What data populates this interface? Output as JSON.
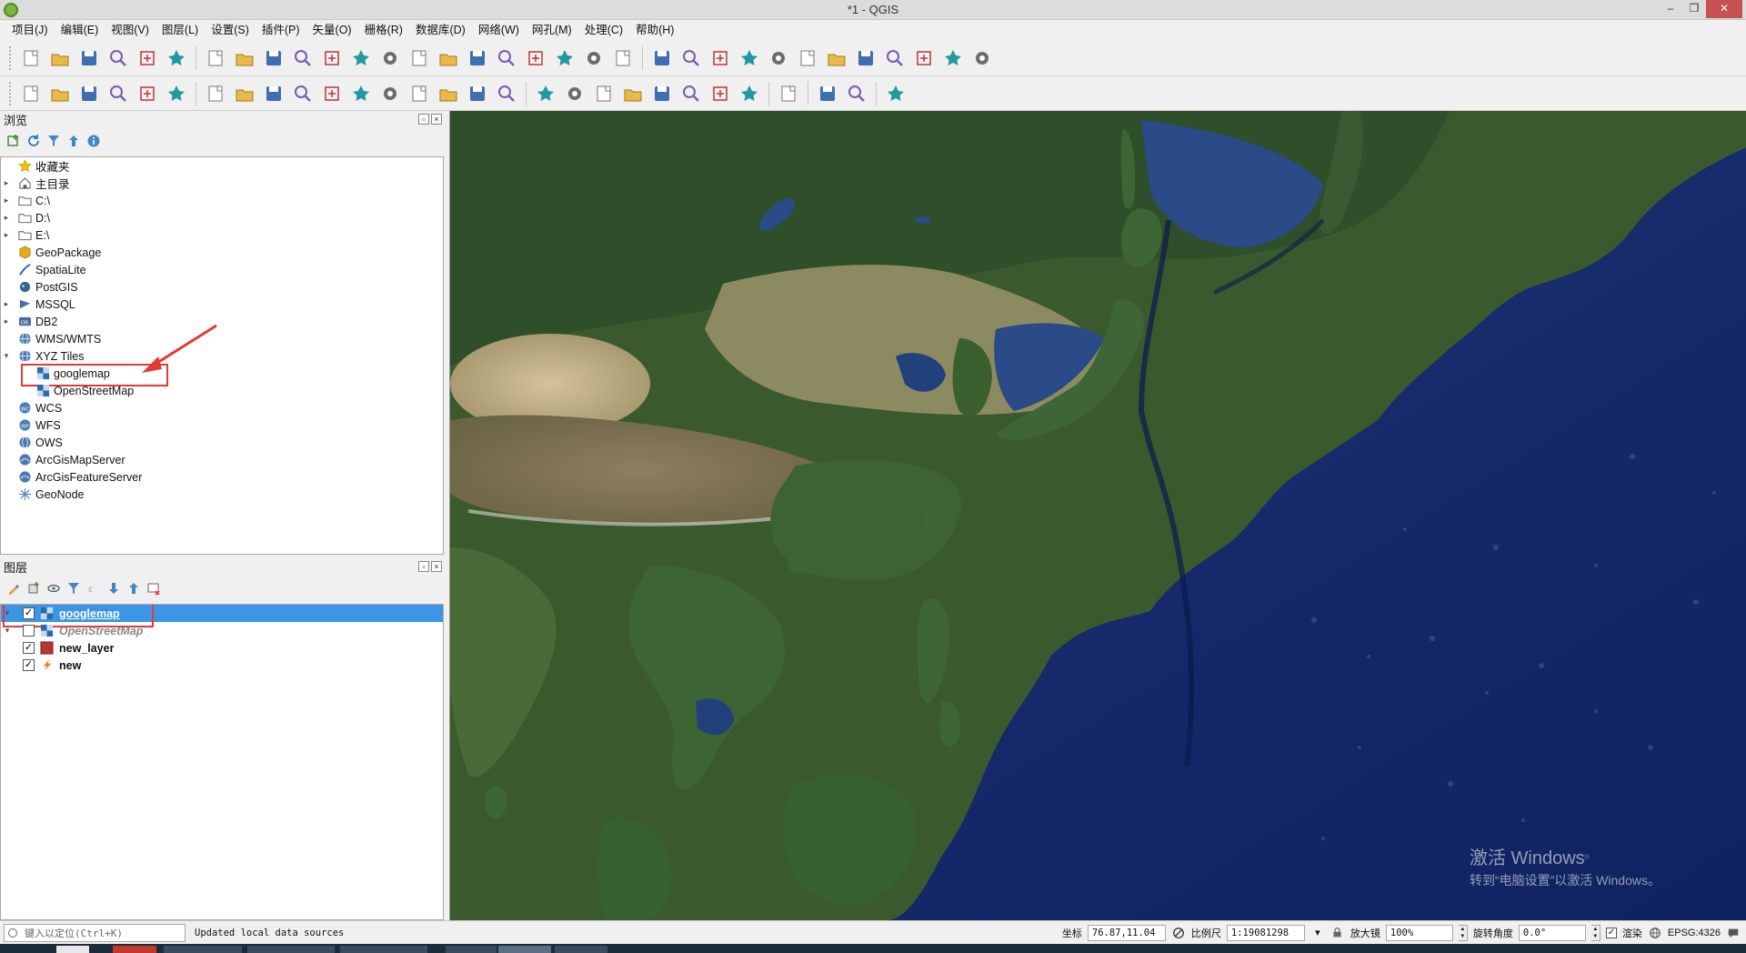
{
  "window": {
    "title": "*1 - QGIS",
    "minimize": "–",
    "maximize": "❐",
    "close": "✕"
  },
  "menu": [
    "项目(J)",
    "编辑(E)",
    "视图(V)",
    "图层(L)",
    "设置(S)",
    "插件(P)",
    "矢量(O)",
    "栅格(R)",
    "数据库(D)",
    "网络(W)",
    "网孔(M)",
    "处理(C)",
    "帮助(H)"
  ],
  "toolbar1": [
    "new-project-icon",
    "open-project-icon",
    "save-project-icon",
    "save-as-icon",
    "print-layout-icon",
    "layout-manager-icon",
    "|",
    "pan-icon",
    "pan-to-selection-icon",
    "zoom-in-icon",
    "zoom-out-icon",
    "zoom-full-icon",
    "zoom-to-selection-icon",
    "zoom-to-layer-icon",
    "zoom-native-icon",
    "zoom-last-icon",
    "zoom-next-icon",
    "new-map-view-icon",
    "new-3d-view-icon",
    "bookmark-icon",
    "show-bookmarks-icon",
    "refresh-icon",
    "|",
    "identify-icon",
    "select-feature-icon",
    "select-by-value-icon",
    "deselect-icon",
    "open-attribute-table-icon",
    "field-calculator-icon",
    "statistics-icon",
    "toolbox-icon",
    "sum-icon",
    "measure-icon",
    "map-tips-icon",
    "text-annotation-icon"
  ],
  "toolbar2": [
    "add-vector-layer-icon",
    "add-raster-layer-icon",
    "add-delimited-text-icon",
    "add-spatialite-icon",
    "add-wms-icon",
    "new-shapefile-icon",
    "|",
    "current-edits-icon",
    "toggle-editing-icon",
    "save-edits-icon",
    "add-feature-icon",
    "vertex-tool-icon",
    "delete-selected-icon",
    "cut-features-icon",
    "copy-features-icon",
    "paste-features-icon",
    "undo-icon",
    "redo-icon",
    "|",
    "label-icon",
    "diagram-icon",
    "highlight-pin-icon",
    "pin-label-icon",
    "show-hide-labels-icon",
    "move-label-icon",
    "rotate-label-icon",
    "change-label-icon",
    "|",
    "globe-icon",
    "|",
    "python-icon",
    "plugin-network-icon",
    "|",
    "help-icon"
  ],
  "browser": {
    "title": "浏览",
    "items": [
      {
        "label": "收藏夹",
        "icon": "star-icon",
        "arrow": ""
      },
      {
        "label": "主目录",
        "icon": "home-icon",
        "arrow": "▸"
      },
      {
        "label": "C:\\",
        "icon": "folder-icon",
        "arrow": "▸"
      },
      {
        "label": "D:\\",
        "icon": "folder-icon",
        "arrow": "▸"
      },
      {
        "label": "E:\\",
        "icon": "folder-icon",
        "arrow": "▸"
      },
      {
        "label": "GeoPackage",
        "icon": "geopackage-icon",
        "arrow": ""
      },
      {
        "label": "SpatiaLite",
        "icon": "spatialite-icon",
        "arrow": ""
      },
      {
        "label": "PostGIS",
        "icon": "postgis-icon",
        "arrow": ""
      },
      {
        "label": "MSSQL",
        "icon": "mssql-icon",
        "arrow": "▸"
      },
      {
        "label": "DB2",
        "icon": "db2-icon",
        "arrow": "▸"
      },
      {
        "label": "WMS/WMTS",
        "icon": "wms-icon",
        "arrow": ""
      },
      {
        "label": "XYZ Tiles",
        "icon": "xyz-icon",
        "arrow": "▾"
      },
      {
        "label": "googlemap",
        "icon": "tile-icon",
        "arrow": "",
        "child": true,
        "boxed": true
      },
      {
        "label": "OpenStreetMap",
        "icon": "tile-icon",
        "arrow": "",
        "child": true
      },
      {
        "label": "WCS",
        "icon": "wcs-icon",
        "arrow": ""
      },
      {
        "label": "WFS",
        "icon": "wfs-icon",
        "arrow": ""
      },
      {
        "label": "OWS",
        "icon": "ows-icon",
        "arrow": ""
      },
      {
        "label": "ArcGisMapServer",
        "icon": "arcgis-icon",
        "arrow": ""
      },
      {
        "label": "ArcGisFeatureServer",
        "icon": "arcgis-icon",
        "arrow": ""
      },
      {
        "label": "GeoNode",
        "icon": "geonode-icon",
        "arrow": ""
      }
    ]
  },
  "layers": {
    "title": "图层",
    "items": [
      {
        "label": "googlemap",
        "checked": true,
        "selected": true,
        "icon": "tile-icon",
        "arrow": "▾"
      },
      {
        "label": "OpenStreetMap",
        "checked": false,
        "italic": true,
        "icon": "tile-icon",
        "arrow": "▾"
      },
      {
        "label": "new_layer",
        "checked": true,
        "icon": "polygon-layer-icon",
        "arrow": ""
      },
      {
        "label": "new",
        "checked": true,
        "icon": "line-layer-icon",
        "arrow": ""
      }
    ]
  },
  "map": {
    "watermark_line1": "激活 Windows",
    "watermark_line2": "转到“电脑设置”以激活 Windows。"
  },
  "status": {
    "locator_placeholder": "键入以定位(Ctrl+K)",
    "message": "Updated local data sources",
    "coord_label": "坐标",
    "coord_value": "76.87,11.04",
    "scale_label": "比例尺",
    "scale_value": "1:19081298",
    "magnifier_label": "放大镜",
    "magnifier_value": "100%",
    "rotation_label": "旋转角度",
    "rotation_value": "0.0°",
    "render_label": "渲染",
    "crs": "EPSG:4326"
  },
  "colors": {
    "selection": "#3d95e6",
    "highlight_box": "#e53935",
    "ocean": "#1d3570"
  }
}
